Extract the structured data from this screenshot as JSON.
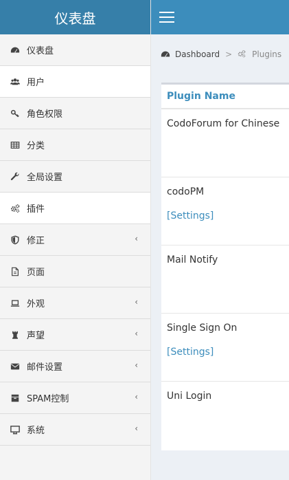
{
  "sidebar": {
    "brand": "仪表盘",
    "items": [
      {
        "label": "仪表盘",
        "icon": "dashboard-icon"
      },
      {
        "label": "用户",
        "icon": "users-icon"
      },
      {
        "label": "角色权限",
        "icon": "key-icon"
      },
      {
        "label": "分类",
        "icon": "table-icon"
      },
      {
        "label": "全局设置",
        "icon": "wrench-icon"
      },
      {
        "label": "插件",
        "icon": "cogs-icon"
      },
      {
        "label": "修正",
        "icon": "shield-icon"
      },
      {
        "label": "页面",
        "icon": "file-icon"
      },
      {
        "label": "外观",
        "icon": "laptop-icon"
      },
      {
        "label": "声望",
        "icon": "chess-rook-icon"
      },
      {
        "label": "邮件设置",
        "icon": "envelope-icon"
      },
      {
        "label": "SPAM控制",
        "icon": "archive-icon"
      },
      {
        "label": "系统",
        "icon": "desktop-icon"
      }
    ],
    "chevron": "‹"
  },
  "topbar": {
    "menu_icon": "hamburger-icon"
  },
  "breadcrumb": {
    "home": "Dashboard",
    "separator": ">",
    "current": "Plugins"
  },
  "table": {
    "header": "Plugin Name",
    "rows": [
      {
        "name": "CodoForum for Chinese",
        "link": ""
      },
      {
        "name": "codoPM",
        "link": "[Settings]"
      },
      {
        "name": "Mail Notify",
        "link": ""
      },
      {
        "name": "Single Sign On",
        "link": "[Settings]"
      },
      {
        "name": "Uni Login",
        "link": ""
      }
    ]
  },
  "colors": {
    "brand_bg": "#367fa9",
    "topbar_bg": "#3c8dbc",
    "link": "#3c8dbc",
    "sidebar_bg": "#f4f4f4"
  }
}
